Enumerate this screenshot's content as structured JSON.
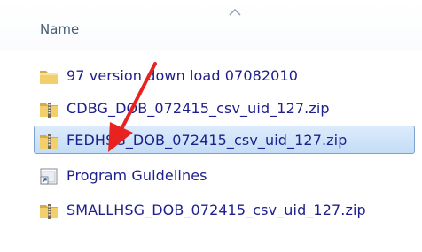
{
  "column_header": {
    "name_label": "Name"
  },
  "files": [
    {
      "name": "97 version down load 07082010",
      "icon": "folder-icon",
      "selected": false
    },
    {
      "name": "CDBG_DOB_072415_csv_uid_127.zip",
      "icon": "zip-folder-icon",
      "selected": false
    },
    {
      "name": "FEDHSG_DOB_072415_csv_uid_127.zip",
      "icon": "zip-folder-icon",
      "selected": true
    },
    {
      "name": "Program Guidelines",
      "icon": "shortcut-icon",
      "selected": false
    },
    {
      "name": "SMALLHSG_DOB_072415_csv_uid_127.zip",
      "icon": "zip-folder-icon",
      "selected": false
    }
  ],
  "colors": {
    "link_text": "#1e1e8c",
    "selection_fill": "#c4ddf6",
    "selection_border": "#7da2ce",
    "annotation_arrow": "#e8231f"
  }
}
